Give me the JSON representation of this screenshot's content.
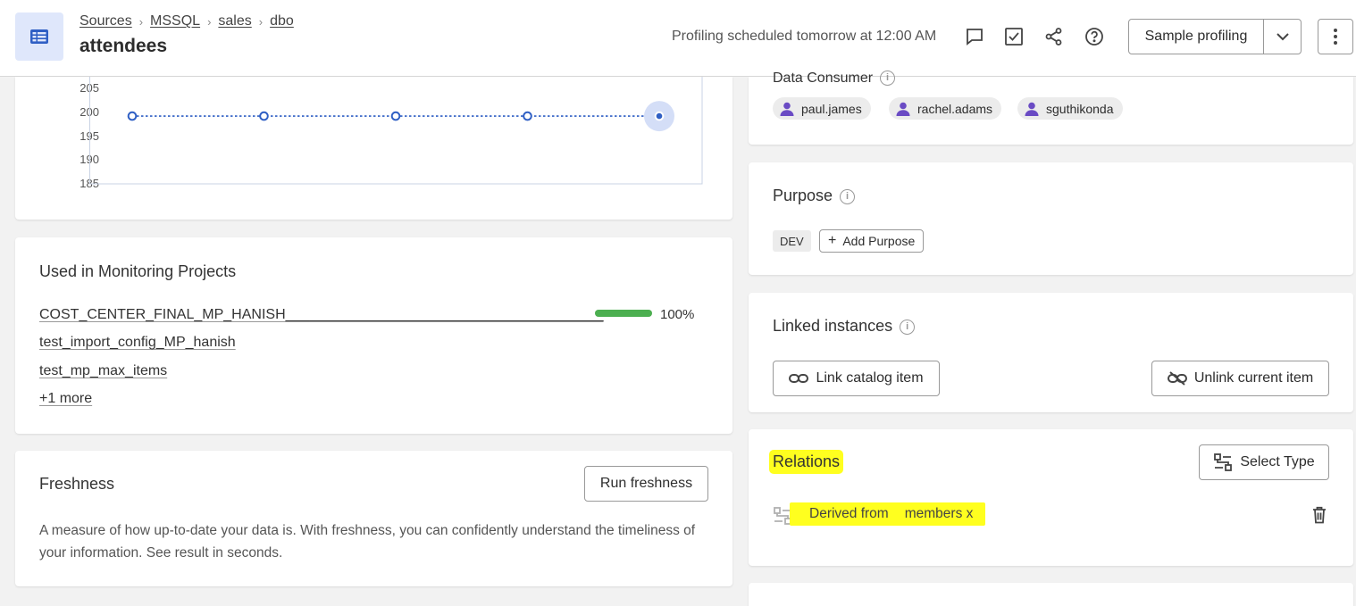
{
  "header": {
    "breadcrumb": [
      "Sources",
      "MSSQL",
      "sales",
      "dbo"
    ],
    "title": "attendees",
    "schedule_text": "Profiling scheduled tomorrow at 12:00 AM",
    "sample_button": "Sample profiling",
    "icons": [
      "table-icon",
      "comment-icon",
      "checkbox-icon",
      "share-icon",
      "help-icon",
      "chevron-down-icon",
      "more-vertical-icon"
    ]
  },
  "chart": {
    "y_ticks": [
      "205",
      "200",
      "195",
      "190",
      "185"
    ]
  },
  "chart_data": {
    "type": "line",
    "x": [
      1,
      2,
      3,
      4,
      5
    ],
    "values": [
      199,
      199,
      199,
      199,
      199
    ],
    "ylim": [
      185,
      207
    ],
    "yticks": [
      205,
      200,
      195,
      190,
      185
    ],
    "style": "dotted",
    "color": "#2f5fc4",
    "highlighted_point": 5
  },
  "monitoring": {
    "title": "Used in Monitoring Projects",
    "projects": [
      "COST_CENTER_FINAL_MP_HANISH________________________________________",
      "test_import_config_MP_hanish",
      "test_mp_max_items"
    ],
    "more_link": "+1 more",
    "progress_percent": 100,
    "progress_label": "100%",
    "progress_color": "#4caf50"
  },
  "freshness": {
    "title": "Freshness",
    "button": "Run freshness",
    "description_line1": "A measure of how up-to-date your data is. With freshness, you can confidently understand the timeliness of",
    "description_line2": "your information. See result in seconds."
  },
  "consumer": {
    "title": "Data Consumer",
    "users": [
      "paul.james",
      "rachel.adams",
      "sguthikonda"
    ]
  },
  "purpose": {
    "title": "Purpose",
    "tag": "DEV",
    "add_button": "Add Purpose"
  },
  "linked": {
    "title": "Linked instances",
    "link_button": "Link catalog item",
    "unlink_button": "Unlink current item"
  },
  "relations": {
    "title": "Relations",
    "select_button": "Select Type",
    "relation_type": "Derived from",
    "relation_target": "members x",
    "highlight_color": "#ffff1f"
  },
  "colors": {
    "accent_blue": "#2f5fc4",
    "tile_bg": "#dfe7fb",
    "avatar_purple": "#6a4bc4"
  }
}
